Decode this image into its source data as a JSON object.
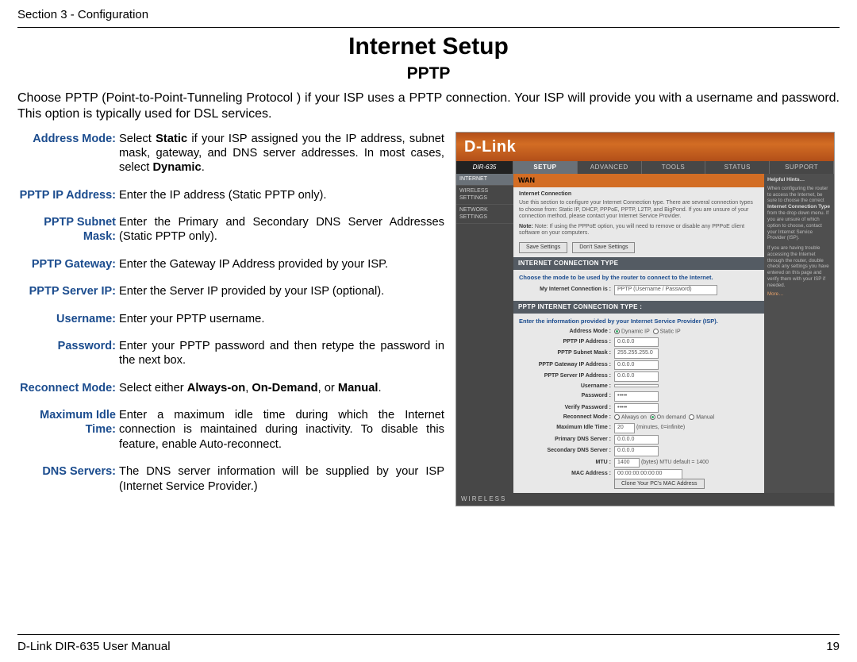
{
  "header": {
    "section": "Section 3 - Configuration"
  },
  "title": "Internet Setup",
  "subtitle": "PPTP",
  "intro": "Choose PPTP (Point-to-Point-Tunneling Protocol ) if your ISP uses a PPTP connection. Your ISP will provide you with a username and password. This option is typically used for DSL services.",
  "definitions": [
    {
      "label": "Address Mode:",
      "html": "Select <b>Static</b> if your ISP assigned you the IP address, subnet mask, gateway, and DNS server addresses. In most cases, select <b>Dynamic</b>."
    },
    {
      "label": "PPTP IP Address:",
      "html": "Enter the IP address (Static PPTP only)."
    },
    {
      "label": "PPTP Subnet Mask:",
      "html": "Enter the Primary and Secondary DNS Server Addresses (Static PPTP only)."
    },
    {
      "label": "PPTP Gateway:",
      "html": "Enter the Gateway IP Address provided by your ISP."
    },
    {
      "label": "PPTP Server IP:",
      "html": "Enter the Server IP provided by your ISP (optional)."
    },
    {
      "label": "Username:",
      "html": "Enter your PPTP username."
    },
    {
      "label": "Password:",
      "html": "Enter your PPTP password and then retype the password in the next box."
    },
    {
      "label": "Reconnect Mode:",
      "html": "Select either <b>Always-on</b>, <b>On-Demand</b>, or <b>Manual</b>."
    },
    {
      "label": "Maximum Idle Time:",
      "html": "Enter a maximum idle time during which the Internet connection is maintained during inactivity. To disable this feature, enable Auto-reconnect."
    },
    {
      "label": "DNS Servers:",
      "html": "The DNS server information will be supplied by your ISP (Internet Service Provider.)"
    }
  ],
  "footer": {
    "manual": "D-Link DIR-635 User Manual",
    "page": "19"
  },
  "ui": {
    "brand": "D-Link",
    "model": "DIR-635",
    "tabs": [
      "SETUP",
      "ADVANCED",
      "TOOLS",
      "STATUS",
      "SUPPORT"
    ],
    "tab_active": 0,
    "sidebar": [
      "INTERNET",
      "WIRELESS SETTINGS",
      "NETWORK SETTINGS"
    ],
    "sidebar_active": 0,
    "wan": {
      "title": "WAN",
      "sub_title": "Internet Connection",
      "desc": "Use this section to configure your Internet Connection type. There are several connection types to choose from: Static IP, DHCP, PPPoE, PPTP, L2TP, and BigPond. If you are unsure of your connection method, please contact your Internet Service Provider.",
      "note": "Note: If using the PPPoE option, you will need to remove or disable any PPPoE client software on your computers.",
      "btn_save": "Save Settings",
      "btn_dont": "Don't Save Settings"
    },
    "conn_type": {
      "header": "INTERNET CONNECTION TYPE",
      "instr": "Choose the mode to be used by the router to connect to the Internet.",
      "label": "My Internet Connection is :",
      "value": "PPTP (Username / Password)"
    },
    "pptp": {
      "header": "PPTP INTERNET CONNECTION TYPE :",
      "instr": "Enter the information provided by your Internet Service Provider (ISP).",
      "fields": {
        "address_mode_label": "Address Mode :",
        "address_mode_opts": [
          "Dynamic IP",
          "Static IP"
        ],
        "ip_label": "PPTP IP Address :",
        "ip": "0.0.0.0",
        "mask_label": "PPTP Subnet Mask :",
        "mask": "255.255.255.0",
        "gw_label": "PPTP Gateway IP Address :",
        "gw": "0.0.0.0",
        "srv_label": "PPTP Server IP Address :",
        "srv": "0.0.0.0",
        "user_label": "Username :",
        "user": "",
        "pass_label": "Password :",
        "pass": "•••••",
        "vpass_label": "Verify Password :",
        "vpass": "•••••",
        "recon_label": "Reconnect Mode :",
        "recon_opts": [
          "Always on",
          "On demand",
          "Manual"
        ],
        "idle_label": "Maximum Idle Time :",
        "idle": "20",
        "idle_suffix": "(minutes, 0=infinite)",
        "dns1_label": "Primary DNS Server :",
        "dns1": "0.0.0.0",
        "dns2_label": "Secondary DNS Server :",
        "dns2": "0.0.0.0",
        "mtu_label": "MTU :",
        "mtu": "1400",
        "mtu_suffix": "(bytes)  MTU default = 1400",
        "mac_label": "MAC Address :",
        "mac": "00:00:00:00:00:00",
        "clone_btn": "Clone Your PC's MAC Address"
      }
    },
    "help": {
      "title": "Helpful Hints…",
      "body1": "When configuring the router to access the Internet, be sure to choose the correct",
      "bold": "Internet Connection Type",
      "body2": "from the drop down menu. If you are unsure of which option to choose, contact your Internet Service Provider (ISP).",
      "body3": "If you are having trouble accessing the Internet through the router, double check any settings you have entered on this page and verify them with your ISP if needed.",
      "more": "More…"
    },
    "bottom": "WIRELESS"
  }
}
